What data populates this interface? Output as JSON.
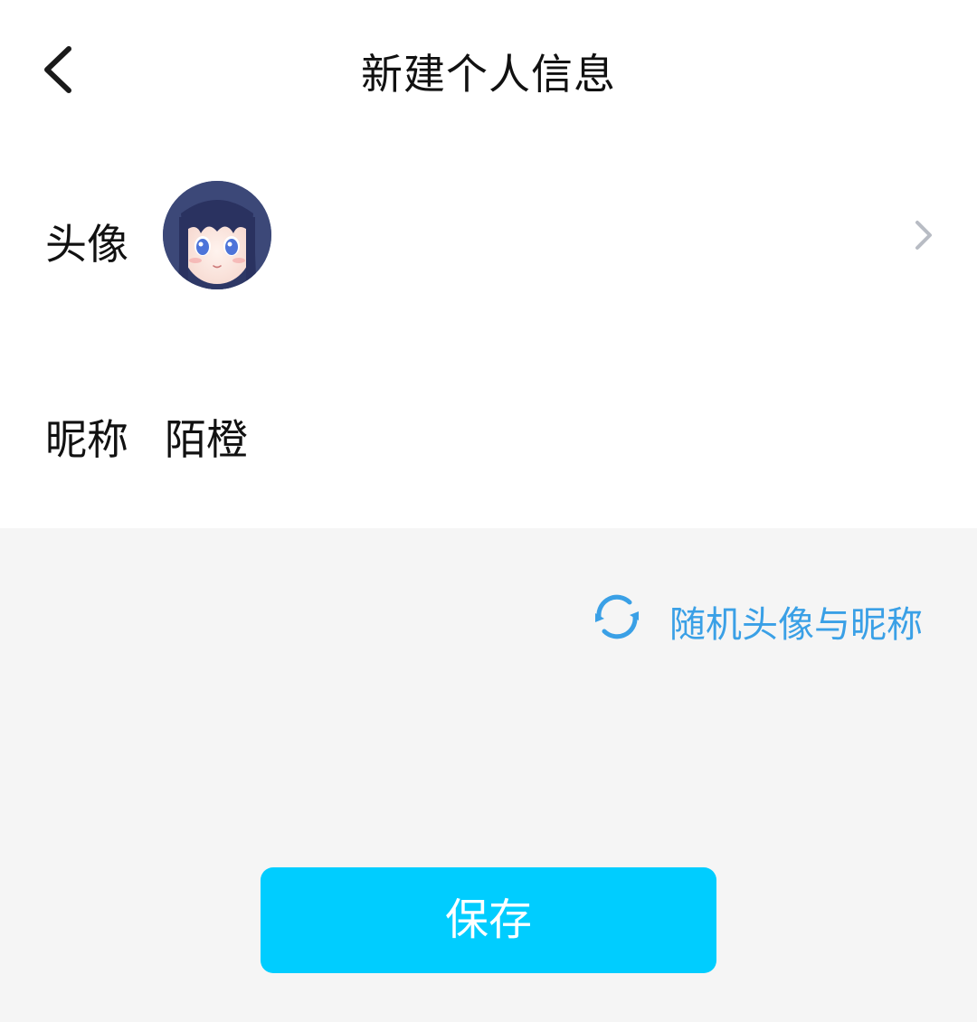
{
  "header": {
    "title": "新建个人信息",
    "back_icon": "chevron-left-icon"
  },
  "form": {
    "avatar": {
      "label": "头像",
      "image": "anime-girl-avatar",
      "chevron_icon": "chevron-right-icon"
    },
    "nickname": {
      "label": "昵称",
      "value": "陌橙"
    }
  },
  "random": {
    "icon": "refresh-icon",
    "label": "随机头像与昵称"
  },
  "save": {
    "label": "保存"
  },
  "colors": {
    "accent": "#00cdff",
    "link": "#3aa0e6",
    "background": "#f5f5f5",
    "card": "#ffffff"
  }
}
